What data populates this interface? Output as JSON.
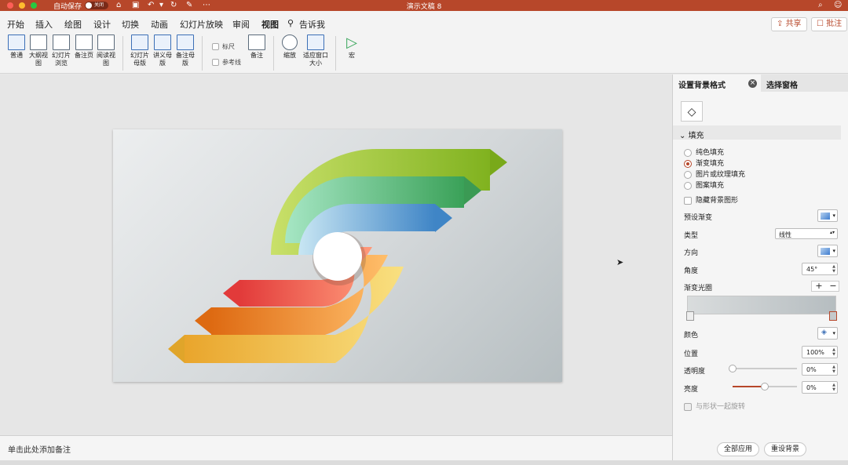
{
  "titlebar": {
    "autosave_label": "自动保存",
    "toggle_label": "关闭",
    "doc_title": "演示文稿 8"
  },
  "menubar": {
    "items": [
      "开始",
      "插入",
      "绘图",
      "设计",
      "切换",
      "动画",
      "幻灯片放映",
      "审阅",
      "视图",
      "告诉我"
    ],
    "active": "视图",
    "share_label": "共享",
    "comment_label": "批注"
  },
  "ribbon": {
    "view_modes": [
      "普通",
      "大纲视图",
      "幻灯片浏览",
      "备注页",
      "阅读视图"
    ],
    "masters": [
      "幻灯片母版",
      "讲义母版",
      "备注母版"
    ],
    "ruler_label": "标尺",
    "guides_label": "参考线",
    "notes_label": "备注",
    "zoom_label": "缩放",
    "fit_label": "适应窗口大小",
    "macro_label": "宏"
  },
  "notes": {
    "placeholder": "单击此处添加备注"
  },
  "pane": {
    "tab_format": "设置背景格式",
    "tab_selection": "选择窗格",
    "section_fill": "填充",
    "fill_options": [
      "纯色填充",
      "渐变填充",
      "图片或纹理填充",
      "图案填充"
    ],
    "selected_fill": "渐变填充",
    "hide_bg_label": "隐藏背景图形",
    "preset_label": "预设渐变",
    "type_label": "类型",
    "type_value": "线性",
    "direction_label": "方向",
    "angle_label": "角度",
    "angle_value": "45°",
    "stops_label": "渐变光圈",
    "color_label": "颜色",
    "position_label": "位置",
    "position_value": "100%",
    "transparency_label": "透明度",
    "transparency_value": "0%",
    "transparency_level": 0,
    "brightness_label": "亮度",
    "brightness_value": "0%",
    "brightness_level": 0.5,
    "rotate_label": "与形状一起旋转",
    "apply_all_label": "全部应用",
    "reset_label": "重设背景"
  }
}
